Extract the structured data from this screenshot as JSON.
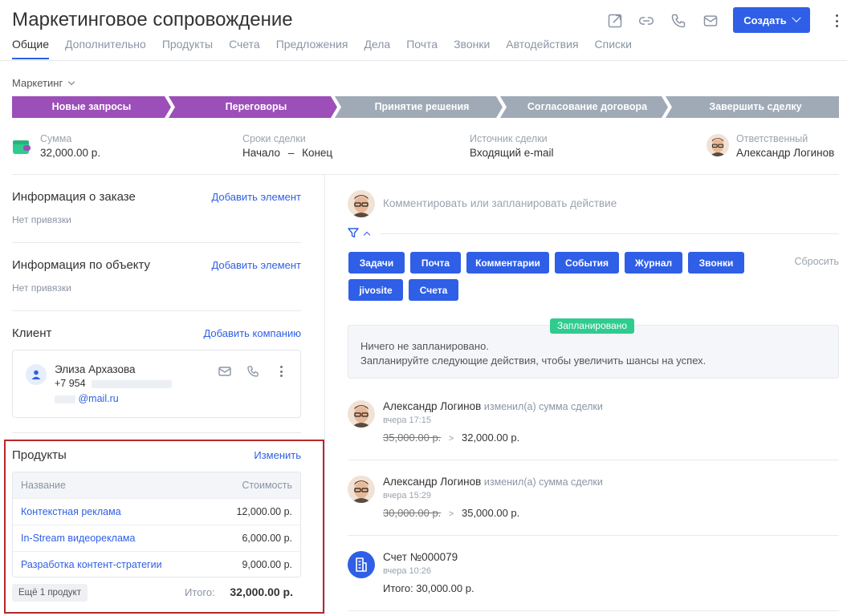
{
  "header": {
    "title": "Маркетинговое сопровождение",
    "create_label": "Создать",
    "icons": [
      "external-link-icon",
      "link-icon",
      "phone-icon",
      "mail-icon",
      "more-vertical-icon"
    ]
  },
  "tabs": [
    "Общие",
    "Дополнительно",
    "Продукты",
    "Счета",
    "Предложения",
    "Дела",
    "Почта",
    "Звонки",
    "Автодействия",
    "Списки"
  ],
  "pipeline": {
    "name": "Маркетинг",
    "stages": [
      {
        "label": "Новые запросы",
        "status": "done",
        "color": "#9c4fb8"
      },
      {
        "label": "Переговоры",
        "status": "current",
        "color": "#9c4fb8"
      },
      {
        "label": "Принятие решения",
        "status": "pending",
        "color": "#a0aab7"
      },
      {
        "label": "Согласование договора",
        "status": "pending",
        "color": "#a0aab7"
      },
      {
        "label": "Завершить сделку",
        "status": "pending",
        "color": "#a0aab7"
      }
    ]
  },
  "info": {
    "sum_label": "Сумма",
    "sum_value": "32,000.00 р.",
    "terms_label": "Сроки сделки",
    "terms_start": "Начало",
    "terms_sep": "–",
    "terms_end": "Конец",
    "source_label": "Источник сделки",
    "source_value": "Входящий e-mail",
    "owner_label": "Ответственный",
    "owner_value": "Александр Логинов"
  },
  "left": {
    "order": {
      "title": "Информация о заказе",
      "action": "Добавить элемент",
      "empty": "Нет привязки"
    },
    "object": {
      "title": "Информация по объекту",
      "action": "Добавить элемент",
      "empty": "Нет привязки"
    },
    "client": {
      "title": "Клиент",
      "action": "Добавить компанию",
      "name": "Элиза Архазова",
      "phone": "+7 954",
      "email": "@mail.ru"
    },
    "products": {
      "title": "Продукты",
      "action": "Изменить",
      "col_name": "Название",
      "col_price": "Стоимость",
      "rows": [
        {
          "name": "Контекстная реклама",
          "price": "12,000.00 р."
        },
        {
          "name": "In-Stream видеореклама",
          "price": "6,000.00 р."
        },
        {
          "name": "Разработка контент-стратегии",
          "price": "9,000.00 р."
        }
      ],
      "more": "Ещё 1 продукт",
      "total_label": "Итого:",
      "total_value": "32,000.00 р."
    }
  },
  "right": {
    "comment_placeholder": "Комментировать или запланировать действие",
    "filters": [
      "Задачи",
      "Почта",
      "Комментарии",
      "События",
      "Журнал",
      "Звонки",
      "jivosite",
      "Счета"
    ],
    "reset_label": "Сбросить",
    "scheduled": {
      "badge": "Запланировано",
      "line1": "Ничего не запланировано.",
      "line2": "Запланируйте следующие действия, чтобы увеличить шансы на успех."
    },
    "events": [
      {
        "author": "Александр Логинов",
        "action": "изменил(а) сумма сделки",
        "time": "вчера 17:15",
        "old": "35,000.00 р.",
        "new": "32,000.00 р."
      },
      {
        "author": "Александр Логинов",
        "action": "изменил(а) сумма сделки",
        "time": "вчера 15:29",
        "old": "30,000.00 р.",
        "new": "35,000.00 р."
      }
    ],
    "invoice": {
      "title": "Счет №000079",
      "time": "вчера 10:26",
      "total": "Итого: 30,000.00 р."
    }
  },
  "colors": {
    "accent": "#2f5fe6",
    "stage_active": "#9c4fb8",
    "stage_pending": "#a0aab7",
    "badge_green": "#2fcc8f",
    "highlight_red": "#b7282b"
  }
}
